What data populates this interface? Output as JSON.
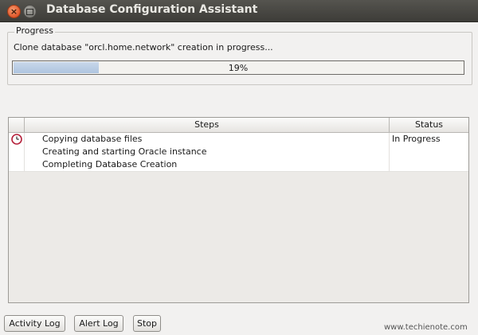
{
  "window": {
    "title": "Database Configuration Assistant",
    "close_glyph": "×"
  },
  "progress": {
    "group_label": "Progress",
    "message": "Clone database \"orcl.home.network\" creation in progress...",
    "percent": 19,
    "percent_label": "19%"
  },
  "steps_table": {
    "headers": {
      "steps": "Steps",
      "status": "Status"
    },
    "rows": [
      {
        "icon": "clock-icon",
        "step": "Copying database files",
        "status": "In Progress"
      },
      {
        "icon": "",
        "step": "Creating and starting Oracle instance",
        "status": ""
      },
      {
        "icon": "",
        "step": "Completing Database Creation",
        "status": ""
      }
    ]
  },
  "buttons": {
    "activity_log": "Activity Log",
    "alert_log": "Alert Log",
    "stop": "Stop"
  },
  "watermark": "www.techienote.com",
  "colors": {
    "titlebar": "#3d3c38",
    "close_button": "#e1572b",
    "progress_fill": "#aec4df",
    "clock_icon": "#b5213b"
  }
}
